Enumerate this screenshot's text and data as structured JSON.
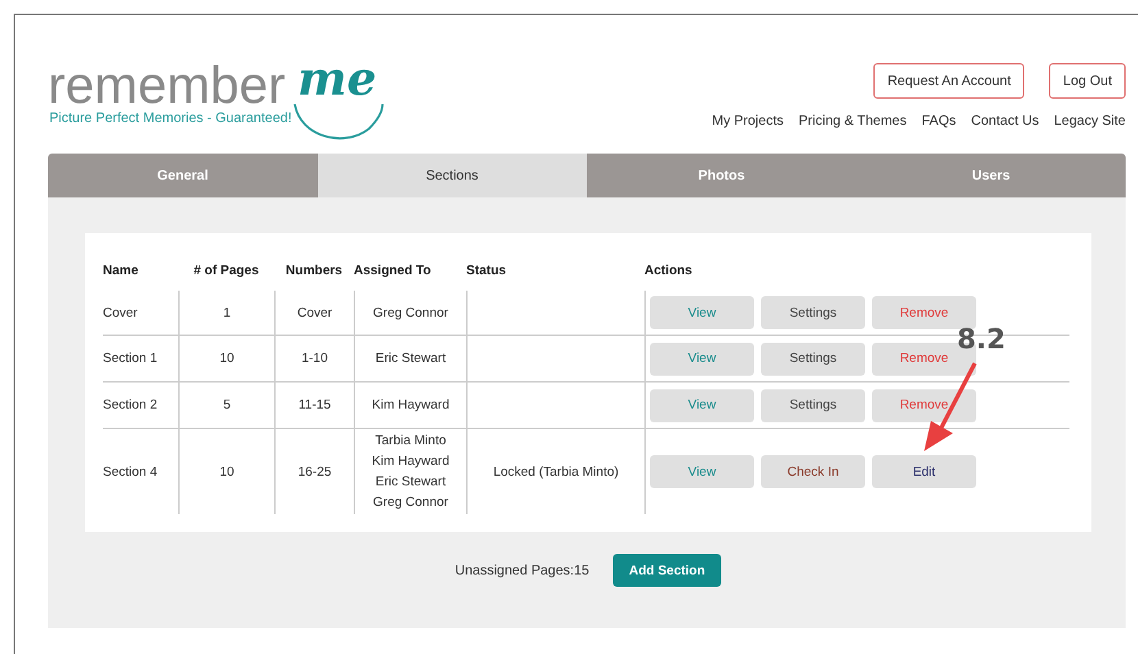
{
  "logo": {
    "word": "remember",
    "accent": "me",
    "tagline": "Picture Perfect Memories - Guaranteed!"
  },
  "header_buttons": [
    "Request An Account",
    "Log Out"
  ],
  "nav": [
    "My Projects",
    "Pricing & Themes",
    "FAQs",
    "Contact Us",
    "Legacy Site"
  ],
  "tabs": [
    {
      "label": "General",
      "selected": false
    },
    {
      "label": "Sections",
      "selected": true
    },
    {
      "label": "Photos",
      "selected": false
    },
    {
      "label": "Users",
      "selected": false
    }
  ],
  "table": {
    "columns": [
      "Name",
      "# of Pages",
      "Numbers",
      "Assigned To",
      "Status",
      "Actions"
    ],
    "rows": [
      {
        "name": "Cover",
        "pages": "1",
        "numbers": "Cover",
        "assigned_to": [
          "Greg Connor"
        ],
        "actions": [
          {
            "label": "View",
            "kind": "view"
          },
          {
            "label": "Settings",
            "kind": "settings"
          },
          {
            "label": "Remove",
            "kind": "remove"
          }
        ]
      },
      {
        "name": "Section 1",
        "pages": "10",
        "numbers": "1-10",
        "assigned_to": [
          "Eric Stewart"
        ],
        "actions": [
          {
            "label": "View",
            "kind": "view"
          },
          {
            "label": "Settings",
            "kind": "settings"
          },
          {
            "label": "Remove",
            "kind": "remove"
          }
        ]
      },
      {
        "name": "Section 2",
        "pages": "5",
        "numbers": "11-15",
        "assigned_to": [
          "Kim Hayward"
        ],
        "actions": [
          {
            "label": "View",
            "kind": "view"
          },
          {
            "label": "Settings",
            "kind": "settings"
          },
          {
            "label": "Remove",
            "kind": "remove"
          }
        ]
      },
      {
        "name": "Section 4",
        "pages": "10",
        "numbers": "16-25",
        "assigned_to": [
          "Tarbia Minto",
          "Kim Hayward",
          "Eric Stewart",
          "Greg Connor"
        ],
        "status": "Locked (Tarbia Minto)",
        "actions": [
          {
            "label": "View",
            "kind": "view"
          },
          {
            "label": "Check In",
            "kind": "checkin"
          },
          {
            "label": "Edit",
            "kind": "edit"
          }
        ]
      }
    ]
  },
  "footer": {
    "unassigned": "Unassigned Pages:15",
    "button": "Add Section"
  },
  "annotation": {
    "label": "8.2"
  }
}
